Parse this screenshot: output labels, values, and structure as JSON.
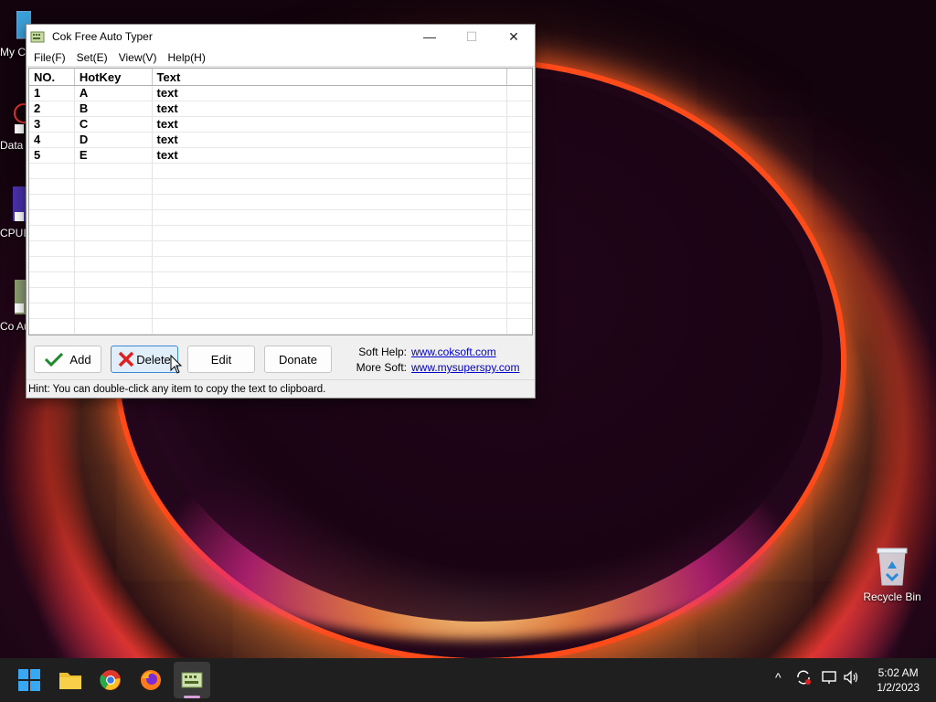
{
  "window": {
    "title": "Cok Free Auto Typer",
    "minimize": "—",
    "maximize": "☐",
    "close": "✕"
  },
  "menu": [
    "File(F)",
    "Set(E)",
    "View(V)",
    "Help(H)"
  ],
  "table": {
    "columns": [
      "NO.",
      "HotKey",
      "Text"
    ],
    "rows": [
      {
        "no": "1",
        "hotkey": "A",
        "text": "text"
      },
      {
        "no": "2",
        "hotkey": "B",
        "text": "text"
      },
      {
        "no": "3",
        "hotkey": "C",
        "text": "text"
      },
      {
        "no": "4",
        "hotkey": "D",
        "text": "text"
      },
      {
        "no": "5",
        "hotkey": "E",
        "text": "text"
      }
    ]
  },
  "buttons": {
    "add": "Add",
    "delete": "Delete",
    "edit": "Edit",
    "donate": "Donate"
  },
  "help": {
    "soft_help_label": "Soft Help:",
    "soft_help_link": "www.coksoft.com",
    "more_soft_label": "More Soft:",
    "more_soft_link": "www.mysuperspy.com"
  },
  "status": "Hint: You can double-click any item to copy the text to clipboard.",
  "desktop": {
    "recycle_bin": "Recycle Bin",
    "side_labels": [
      "My C",
      "Data",
      "CPUI",
      "Co Aut"
    ]
  },
  "taskbar": {
    "time": "5:02 AM",
    "date": "1/2/2023",
    "tray_up": "^"
  },
  "colors": {
    "link": "#0000cc",
    "delete_btn_border": "#3a8ad8",
    "taskbar": "#1f1f1f"
  }
}
